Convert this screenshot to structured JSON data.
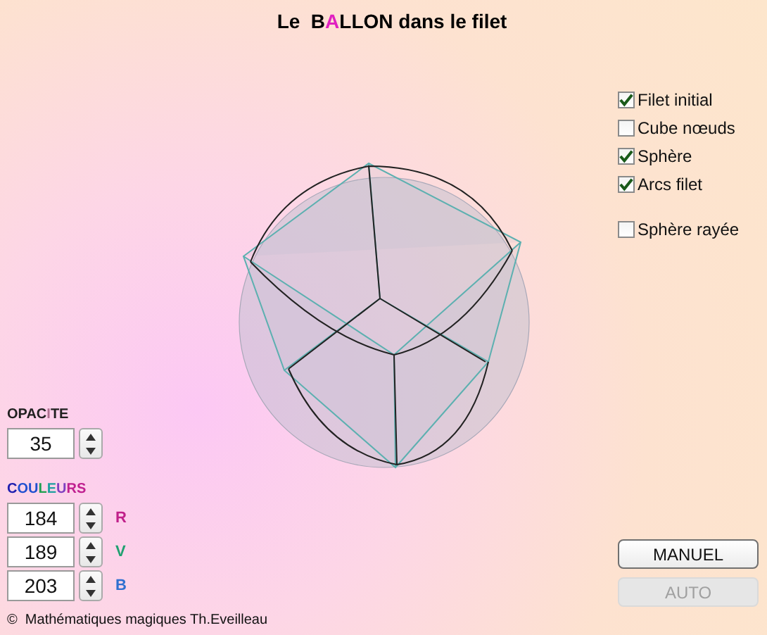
{
  "title": [
    {
      "text": "Le  B",
      "color": "#000000"
    },
    {
      "text": "A",
      "color": "#e020c0"
    },
    {
      "text": "LLON dans le filet",
      "color": "#000000"
    }
  ],
  "options": [
    {
      "label": "Filet initial",
      "checked": true
    },
    {
      "label": "Cube nœuds",
      "checked": false
    },
    {
      "label": "Sphère",
      "checked": true
    },
    {
      "label": "Arcs filet",
      "checked": true
    },
    {
      "label": "Sphère rayée",
      "checked": false
    }
  ],
  "opacity": {
    "label": [
      {
        "text": "OPAC",
        "color": "#202020"
      },
      {
        "text": "I",
        "color": "#b07090"
      },
      {
        "text": "TE",
        "color": "#202020"
      }
    ],
    "value": "35"
  },
  "colors": {
    "label": [
      {
        "text": "C",
        "color": "#2020b0"
      },
      {
        "text": "OU",
        "color": "#2050d0"
      },
      {
        "text": "L",
        "color": "#20a050"
      },
      {
        "text": "E",
        "color": "#20a0a0"
      },
      {
        "text": "U",
        "color": "#8040c0"
      },
      {
        "text": "RS",
        "color": "#c02090"
      }
    ],
    "channels": [
      {
        "value": "184",
        "letter": "R",
        "color": "#c0208a"
      },
      {
        "value": "189",
        "letter": "V",
        "color": "#20a070"
      },
      {
        "value": "203",
        "letter": "B",
        "color": "#3070d0"
      }
    ]
  },
  "buttons": [
    {
      "label": "MANUEL",
      "disabled": false
    },
    {
      "label": "AUTO",
      "disabled": true
    }
  ],
  "footer": "©  Mathématiques magiques Th.Eveilleau"
}
